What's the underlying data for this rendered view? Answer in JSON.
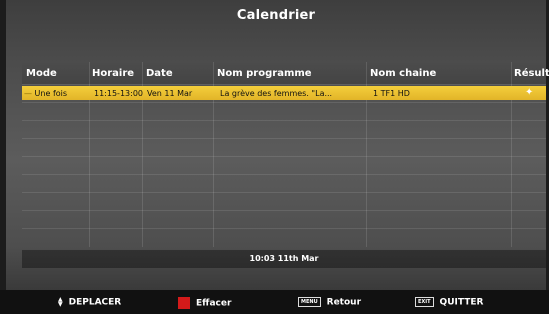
{
  "title": "Calendrier",
  "columns": [
    "Mode",
    "Horaire",
    "Date",
    "Nom programme",
    "Nom chaine",
    "Résult.."
  ],
  "rows": [
    {
      "mode": "Une fois",
      "horaire": "11:15-13:00",
      "date": "Ven 11 Mar",
      "programme": "La grève des femmes. \"La...",
      "chaine": "1 TF1 HD",
      "resultat_icon": "star-icon"
    }
  ],
  "status": "10:03 11th Mar",
  "footer": {
    "move": "DEPLACER",
    "delete": "Effacer",
    "back_key": "MENU",
    "back": "Retour",
    "exit_key": "EXIT",
    "quit": "QUITTER"
  },
  "colors": {
    "selected_row": "#f4cf3c",
    "delete_key": "#d41a1a"
  }
}
